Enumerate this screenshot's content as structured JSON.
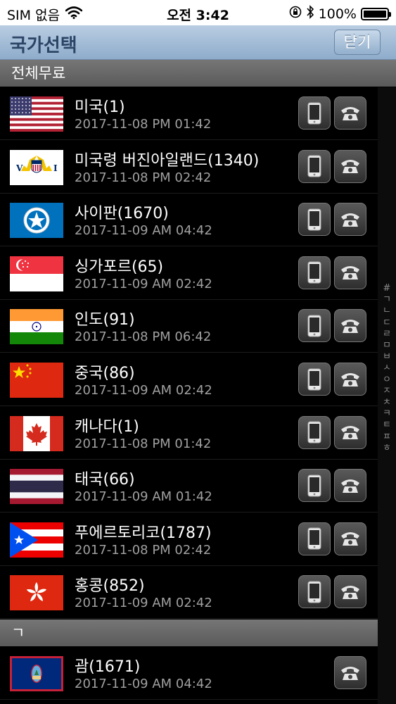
{
  "status_bar": {
    "carrier": "SIM 없음",
    "time": "오전 3:42",
    "battery": "100%",
    "icons": [
      "wifi-icon",
      "orientation-lock-icon",
      "bluetooth-icon",
      "battery-icon"
    ]
  },
  "nav": {
    "title": "국가선택",
    "close_label": "닫기"
  },
  "sections": [
    {
      "title": "전체무료"
    },
    {
      "title": "ㄱ"
    }
  ],
  "rows": [
    {
      "flag": "us",
      "name": "미국(1)",
      "date": "2017-11-08 PM 01:42",
      "mobile": true
    },
    {
      "flag": "vi",
      "name": "미국령 버진아일랜드(1340)",
      "date": "2017-11-08 PM 02:42",
      "mobile": true
    },
    {
      "flag": "mp",
      "name": "사이판(1670)",
      "date": "2017-11-09 AM 04:42",
      "mobile": true
    },
    {
      "flag": "sg",
      "name": "싱가포르(65)",
      "date": "2017-11-09 AM 02:42",
      "mobile": true
    },
    {
      "flag": "in",
      "name": "인도(91)",
      "date": "2017-11-08 PM 06:42",
      "mobile": true
    },
    {
      "flag": "cn",
      "name": "중국(86)",
      "date": "2017-11-09 AM 02:42",
      "mobile": true
    },
    {
      "flag": "ca",
      "name": "캐나다(1)",
      "date": "2017-11-08 PM 01:42",
      "mobile": true
    },
    {
      "flag": "th",
      "name": "태국(66)",
      "date": "2017-11-09 AM 01:42",
      "mobile": true
    },
    {
      "flag": "pr",
      "name": "푸에르토리코(1787)",
      "date": "2017-11-08 PM 02:42",
      "mobile": true
    },
    {
      "flag": "hk",
      "name": "홍콩(852)",
      "date": "2017-11-09 AM 02:42",
      "mobile": true
    },
    {
      "flag": "gu",
      "name": "괌(1671)",
      "date": "2017-11-09 AM 04:42",
      "mobile": false
    }
  ],
  "index": [
    "#",
    "ㄱ",
    "ㄴ",
    "ㄷ",
    "ㄹ",
    "ㅁ",
    "ㅂ",
    "ㅅ",
    "ㅇ",
    "ㅈ",
    "ㅊ",
    "ㅋ",
    "ㅌ",
    "ㅍ",
    "ㅎ"
  ],
  "colors": {
    "nav_gradient_top": "#b9cde2",
    "nav_gradient_bottom": "#8eaccb",
    "nav_title": "#2c4566",
    "section_header": "#676767",
    "row_background": "#000000",
    "date_text": "#a0a0a0"
  }
}
